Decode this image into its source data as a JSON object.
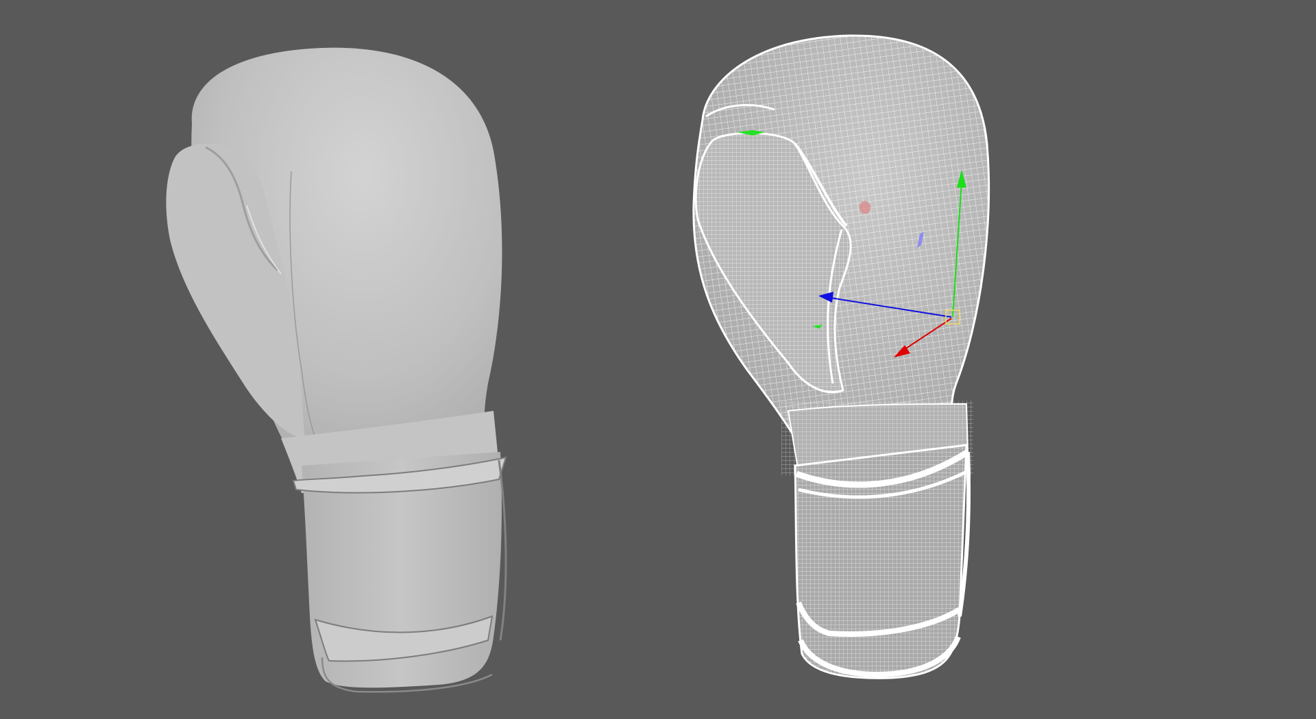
{
  "viewport": {
    "background": "#595959",
    "objects": [
      {
        "name": "boxing-glove-shaded",
        "display_mode": "smooth-shaded"
      },
      {
        "name": "boxing-glove-wireframe",
        "display_mode": "wireframe-on-shaded",
        "selected": true
      }
    ],
    "manipulator": {
      "type": "move",
      "axes": [
        {
          "axis": "x",
          "color": "#e00000"
        },
        {
          "axis": "y",
          "color": "#18e018"
        },
        {
          "axis": "z",
          "color": "#1010e0"
        }
      ],
      "center_color": "#f0e060"
    },
    "colors": {
      "glove_shaded": "#bdbdbd",
      "glove_highlight": "#d2d2d2",
      "wire": "#ffffff"
    }
  }
}
